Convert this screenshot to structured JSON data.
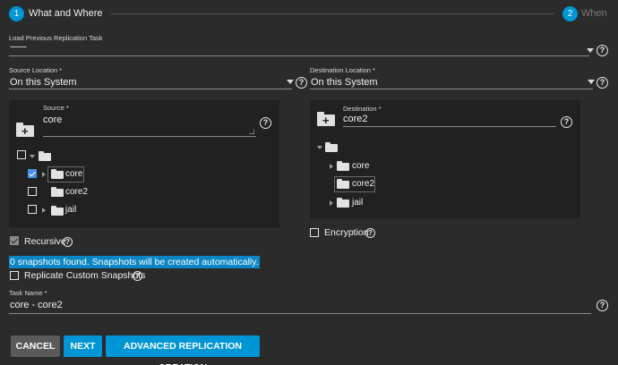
{
  "stepper": {
    "step1_num": "1",
    "step1_label": "What and Where",
    "step2_num": "2",
    "step2_label": "When"
  },
  "load_previous": {
    "label": "Load Previous Replication Task",
    "value": "---------"
  },
  "source_location": {
    "label": "Source Location *",
    "value": "On this System"
  },
  "destination_location": {
    "label": "Destination Location *",
    "value": "On this System"
  },
  "source": {
    "label": "Source *",
    "value": "core",
    "tree": [
      {
        "label": "core",
        "checked": true
      },
      {
        "label": "core2",
        "checked": false
      },
      {
        "label": "jail",
        "checked": false
      }
    ]
  },
  "destination": {
    "label": "Destination *",
    "value": "core2",
    "tree": [
      {
        "label": "core"
      },
      {
        "label": "core2"
      },
      {
        "label": "jail"
      }
    ]
  },
  "recursive_label": "Recursive",
  "encryption_label": "Encryption",
  "info_banner": "0 snapshots found. Snapshots will be created automatically.",
  "replicate_custom_label": "Replicate Custom Snapshots",
  "task_name": {
    "label": "Task Name *",
    "value": "core - core2"
  },
  "buttons": {
    "cancel": "CANCEL",
    "next": "NEXT",
    "advanced": "ADVANCED REPLICATION CREATION"
  },
  "colors": {
    "accent": "#0095d5",
    "background": "#2b2b2b",
    "panel": "#212121"
  }
}
